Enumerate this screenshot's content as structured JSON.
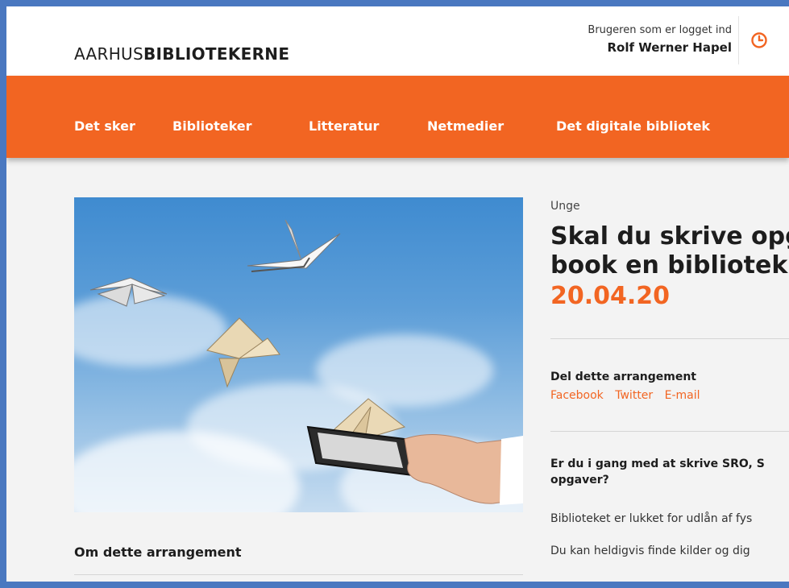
{
  "header": {
    "logo_prefix": "AARHUS",
    "logo_bold": "BIBLIOTEKERNE",
    "user_label": "Brugeren som er logget ind",
    "user_name": "Rolf Werner Hapel",
    "clock_icon": "clock-icon"
  },
  "nav": {
    "items": [
      {
        "label": "Det sker"
      },
      {
        "label": "Biblioteker"
      },
      {
        "label": "Litteratur"
      },
      {
        "label": "Netmedier"
      },
      {
        "label": "Det digitale bibliotek"
      }
    ]
  },
  "event": {
    "category": "Unge",
    "title_line1": "Skal du skrive opg",
    "title_line2": "book en bibliotek",
    "date": "20.04.20",
    "share_heading": "Del dette arrangement",
    "share_links": [
      "Facebook",
      "Twitter",
      "E-mail"
    ],
    "lead_line1": "Er du i gang med at skrive SRO, S",
    "lead_line2": "opgaver?",
    "para1": "Biblioteket er lukket for udlån af fys",
    "para2": "Du kan heldigvis finde kilder og dig",
    "about_heading": "Om dette arrangement"
  },
  "colors": {
    "accent": "#f26522",
    "page_border": "#4a78c0"
  }
}
